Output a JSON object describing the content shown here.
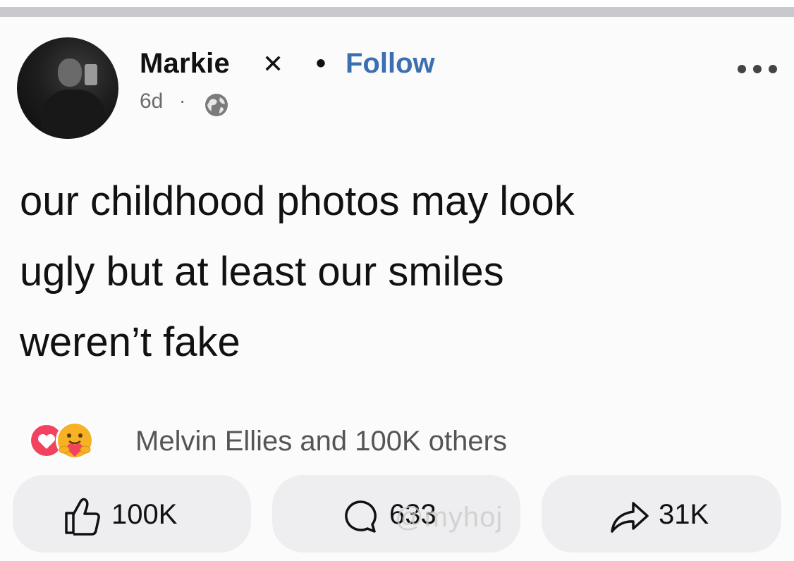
{
  "post": {
    "author_name": "Markie",
    "author_badge": "✕",
    "separator": "•",
    "follow_label": "Follow",
    "time": "6d",
    "time_separator": "·",
    "text_lines": [
      "our childhood photos may look",
      "ugly but at least our smiles",
      "weren’t fake"
    ]
  },
  "reactions": {
    "summary": "Melvin Ellies and 100K others",
    "icons": [
      "heart-reaction-icon",
      "care-reaction-icon"
    ]
  },
  "actions": {
    "like_count": "100K",
    "comment_count": "633",
    "share_count": "31K"
  },
  "watermark": "@myhoj",
  "colors": {
    "follow": "#3b6fb1",
    "heart": "#f3425f",
    "care": "#f7b125",
    "pill_bg": "#eeeef0"
  }
}
